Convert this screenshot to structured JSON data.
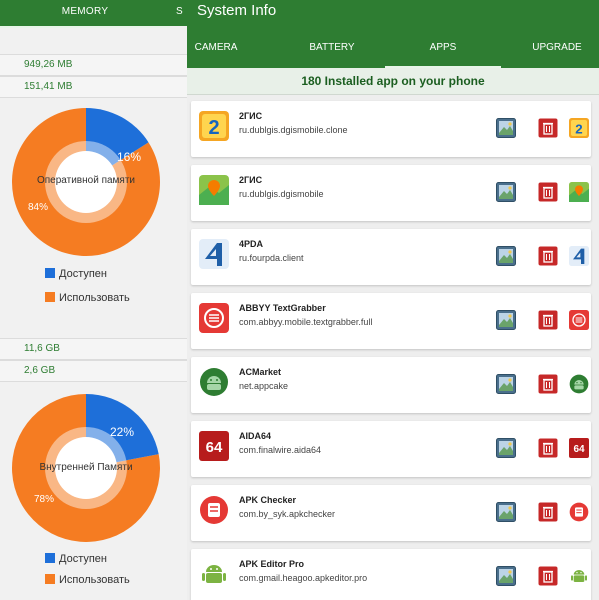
{
  "left_panel": {
    "tab_label": "MEMORY",
    "next_tab_label": "S",
    "ram": {
      "total": "949,26 MB",
      "free": "151,41 MB",
      "chart_label": "Оперативной памяти",
      "available_pct": 16,
      "used_pct": 84,
      "available_text": "16%",
      "used_text": "84%"
    },
    "storage": {
      "total": "11,6 GB",
      "free": "2,6 GB",
      "chart_label": "Внутренней Памяти",
      "available_pct": 22,
      "used_pct": 78,
      "available_text": "22%",
      "used_text": "78%"
    },
    "legend": {
      "available": "Доступен",
      "used": "Использовать"
    },
    "colors": {
      "available": "#1e6fd9",
      "used": "#f57c22"
    }
  },
  "app_bar": {
    "title": "System Info",
    "tabs": [
      "CAMERA",
      "BATTERY",
      "APPS",
      "UPGRADE"
    ],
    "active_tab": "APPS",
    "accent": "#2e7d32"
  },
  "apps_header": "180 Installed app on your phone",
  "apps": [
    {
      "name": "2ГИС",
      "package": "ru.dublgis.dgismobile.clone",
      "icon": "2gis-clone-icon"
    },
    {
      "name": "2ГИС",
      "package": "ru.dublgis.dgismobile",
      "icon": "2gis-map-icon"
    },
    {
      "name": "4PDA",
      "package": "ru.fourpda.client",
      "icon": "4pda-icon"
    },
    {
      "name": "ABBYY TextGrabber",
      "package": "com.abbyy.mobile.textgrabber.full",
      "icon": "textgrabber-icon"
    },
    {
      "name": "ACMarket",
      "package": "net.appcake",
      "icon": "acmarket-android-icon"
    },
    {
      "name": "AIDA64",
      "package": "com.finalwire.aida64",
      "icon": "aida64-icon"
    },
    {
      "name": "APK Checker",
      "package": "com.by_syk.apkchecker",
      "icon": "apk-checker-icon"
    },
    {
      "name": "APK Editor Pro",
      "package": "com.gmail.heagoo.apkeditor.pro",
      "icon": "apk-editor-android-icon"
    }
  ]
}
